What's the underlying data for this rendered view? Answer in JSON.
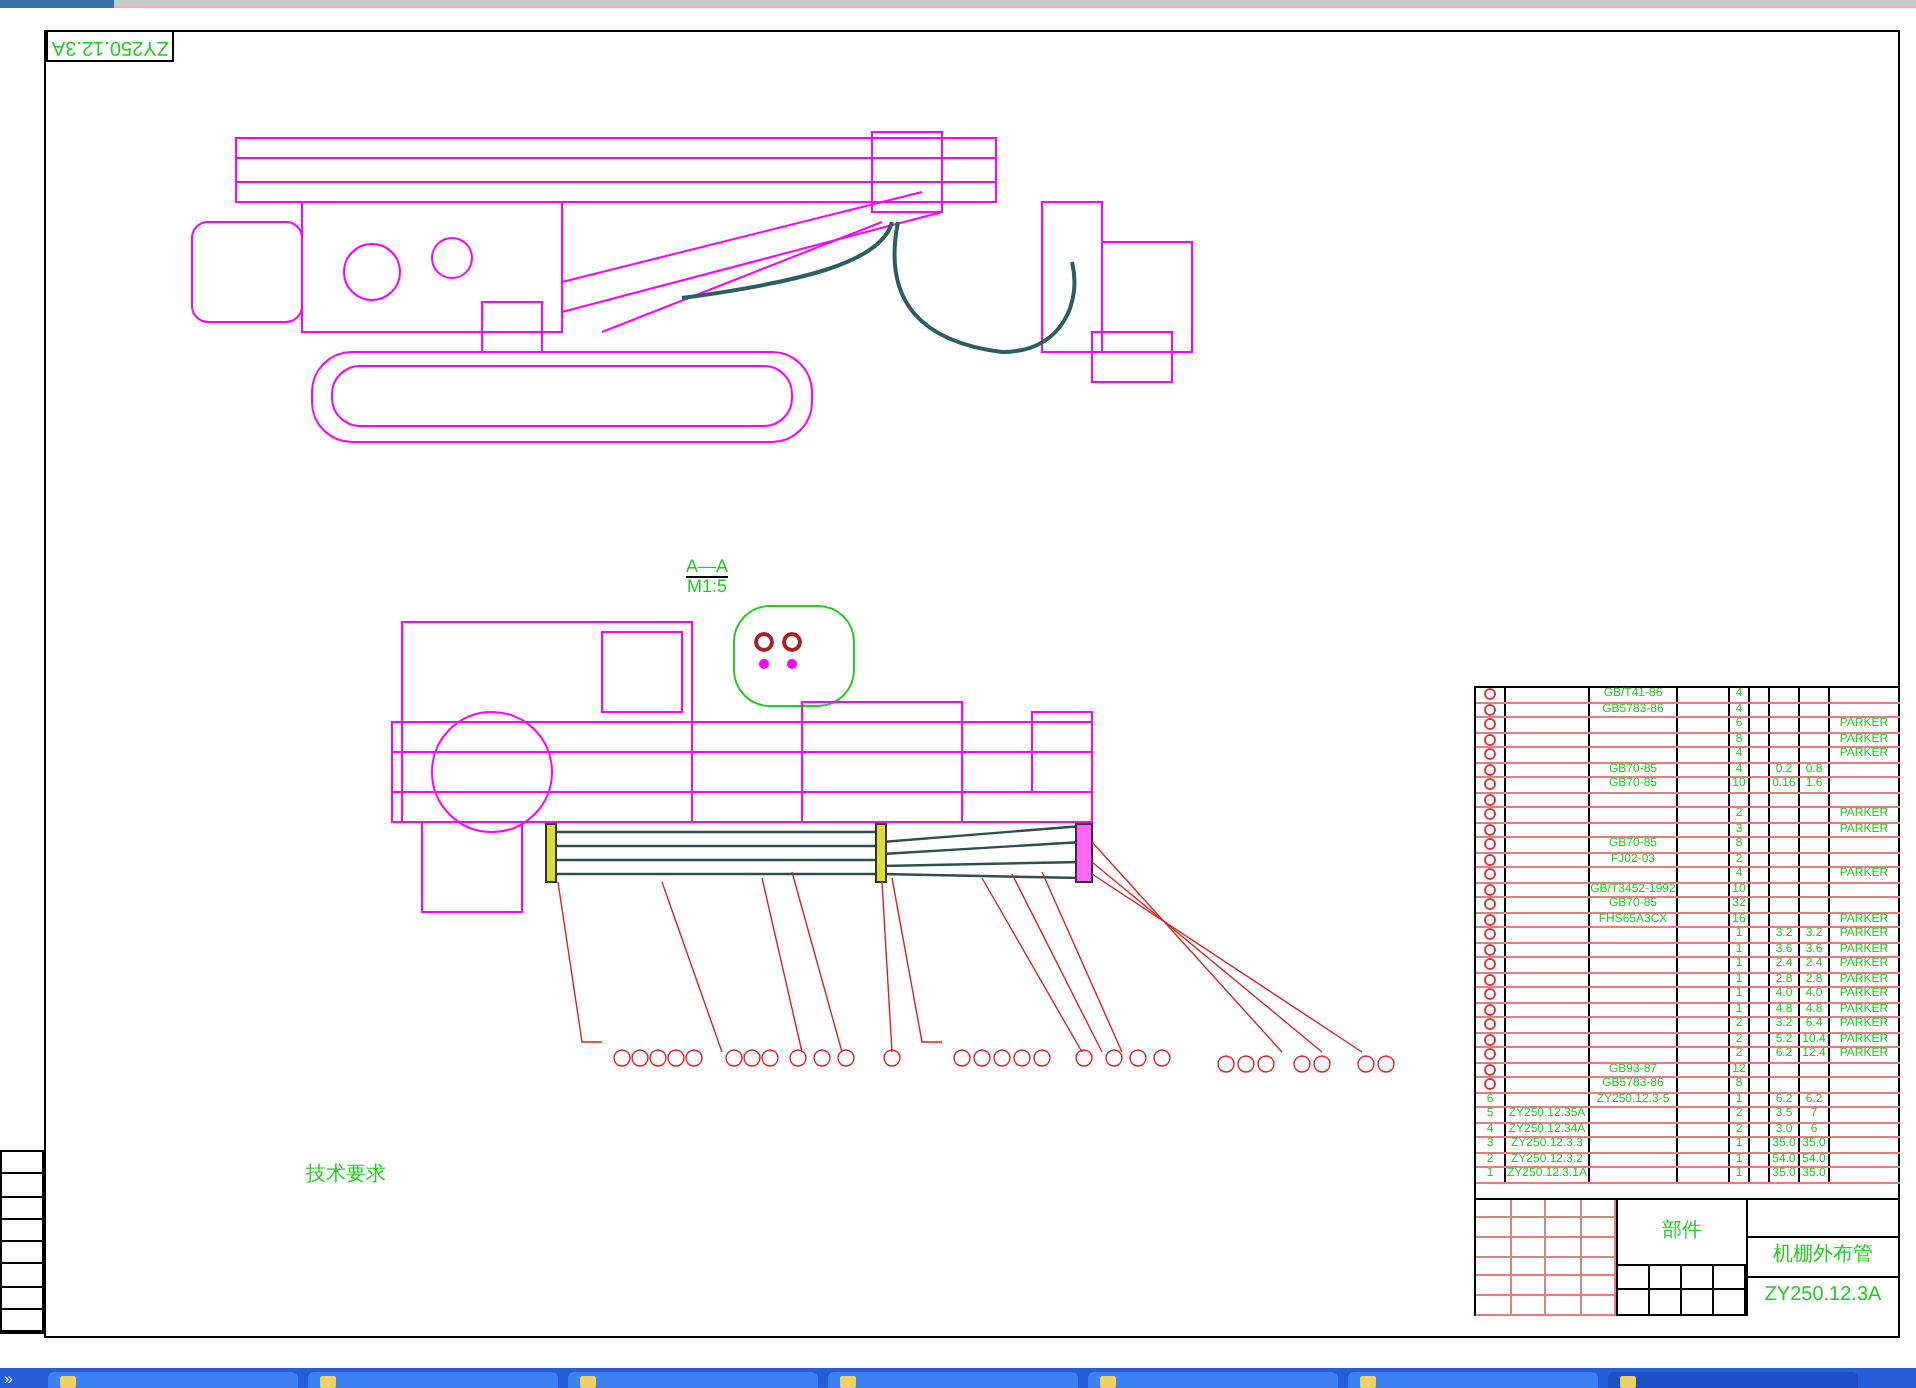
{
  "stamp": {
    "text": "ZY250.12.3A"
  },
  "section_view": {
    "label": "A—A",
    "scale": "M1:5"
  },
  "notes": {
    "title": "技术要求"
  },
  "parts_list": {
    "rows": [
      {
        "circled": true,
        "standard_no": "GB/T41-86",
        "qty": "4"
      },
      {
        "circled": true,
        "standard_no": "GB5783-86",
        "qty": "4"
      },
      {
        "circled": true,
        "qty": "6",
        "remark": "PARKER"
      },
      {
        "circled": true,
        "qty": "8",
        "remark": "PARKER"
      },
      {
        "circled": true,
        "qty": "4",
        "remark": "PARKER"
      },
      {
        "circled": true,
        "standard_no": "GB70-85",
        "qty": "4",
        "unit_weight": "0.2",
        "total_weight": "0.8"
      },
      {
        "circled": true,
        "standard_no": "GB70-85",
        "qty": "10",
        "unit_weight": "0.16",
        "total_weight": "1.6"
      },
      {
        "circled": true
      },
      {
        "circled": true,
        "qty": "2",
        "remark": "PARKER"
      },
      {
        "circled": true,
        "qty": "3",
        "remark": "PARKER"
      },
      {
        "circled": true,
        "standard_no": "GB70-85",
        "qty": "8"
      },
      {
        "circled": true,
        "standard_no": "FJ02-03",
        "qty": "2"
      },
      {
        "circled": true,
        "qty": "4",
        "remark": "PARKER"
      },
      {
        "circled": true,
        "standard_no": "GB/T3452-1992",
        "qty": "10"
      },
      {
        "circled": true,
        "standard_no": "GB70-85",
        "qty": "32"
      },
      {
        "circled": true,
        "standard_no": "FHS65A3CX",
        "qty": "16",
        "remark": "PARKER"
      },
      {
        "circled": true,
        "qty": "1",
        "unit_weight": "3.2",
        "total_weight": "3.2",
        "remark": "PARKER"
      },
      {
        "circled": true,
        "qty": "1",
        "unit_weight": "3.6",
        "total_weight": "3.6",
        "remark": "PARKER"
      },
      {
        "circled": true,
        "qty": "1",
        "unit_weight": "2.4",
        "total_weight": "2.4",
        "remark": "PARKER"
      },
      {
        "circled": true,
        "qty": "1",
        "unit_weight": "2.8",
        "total_weight": "2.8",
        "remark": "PARKER"
      },
      {
        "circled": true,
        "qty": "1",
        "unit_weight": "4.0",
        "total_weight": "4.0",
        "remark": "PARKER"
      },
      {
        "circled": true,
        "qty": "1",
        "unit_weight": "4.8",
        "total_weight": "4.8",
        "remark": "PARKER"
      },
      {
        "circled": true,
        "qty": "2",
        "unit_weight": "3.2",
        "total_weight": "6.4",
        "remark": "PARKER"
      },
      {
        "circled": true,
        "qty": "2",
        "unit_weight": "5.2",
        "total_weight": "10.4",
        "remark": "PARKER"
      },
      {
        "circled": true,
        "qty": "2",
        "unit_weight": "6.2",
        "total_weight": "12.4",
        "remark": "PARKER"
      },
      {
        "circled": true,
        "standard_no": "GB93-87",
        "qty": "12"
      },
      {
        "circled": true,
        "standard_no": "GB5783-86",
        "qty": "8"
      },
      {
        "circled": false,
        "seq": "6",
        "standard_no": "ZY250.12.3-5",
        "qty": "1",
        "unit_weight": "6.2",
        "total_weight": "6.2"
      },
      {
        "circled": false,
        "seq": "5",
        "drawing_no": "ZY250.12.35A",
        "qty": "2",
        "unit_weight": "3.5",
        "total_weight": "7"
      },
      {
        "circled": false,
        "seq": "4",
        "drawing_no": "ZY250.12.34A",
        "qty": "2",
        "unit_weight": "3.0",
        "total_weight": "6"
      },
      {
        "circled": false,
        "seq": "3",
        "drawing_no": "ZY250.12.3.3",
        "qty": "1",
        "unit_weight": "35.0",
        "total_weight": "35.0"
      },
      {
        "circled": false,
        "seq": "2",
        "drawing_no": "ZY250.12.3.2",
        "qty": "1",
        "unit_weight": "54.0",
        "total_weight": "54.0"
      },
      {
        "circled": false,
        "seq": "1",
        "drawing_no": "ZY250.12.3.1A",
        "qty": "1",
        "unit_weight": "35.0",
        "total_weight": "35.0"
      }
    ]
  },
  "title_block": {
    "category": "部件",
    "drawing_title": "机棚外布管",
    "drawing_number": "ZY250.12.3A"
  },
  "taskbar": {
    "chevron": "»",
    "buttons": [
      {
        "selected": false
      },
      {
        "selected": false
      },
      {
        "selected": false
      },
      {
        "selected": false
      },
      {
        "selected": false
      },
      {
        "selected": false
      },
      {
        "selected": true
      }
    ]
  }
}
